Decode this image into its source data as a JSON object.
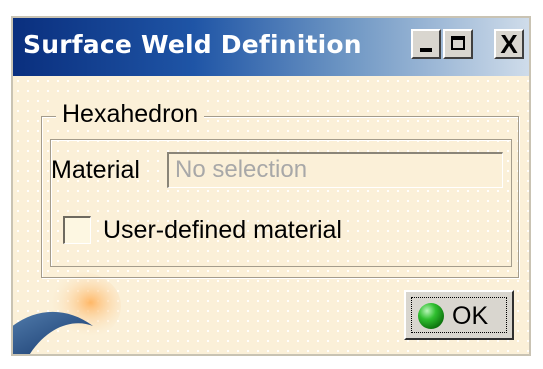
{
  "window": {
    "title": "Surface Weld Definition",
    "controls": [
      "minimize-icon",
      "maximize-icon",
      "close-icon"
    ],
    "close_glyph": "X"
  },
  "group": {
    "title": "Hexahedron",
    "material": {
      "label": "Material",
      "value": "",
      "placeholder": "No selection"
    },
    "user_defined": {
      "label": "User-defined material",
      "checked": false
    }
  },
  "ok_button": {
    "label": "OK",
    "icon": "green-ball-icon"
  },
  "colors": {
    "title_bar_start": "#0a2f7e",
    "title_bar_end": "#cfdcea",
    "dialog_background": "#fbf0d8",
    "placeholder_text": "#a8a8a8",
    "ok_icon": "#2fbf2f"
  }
}
